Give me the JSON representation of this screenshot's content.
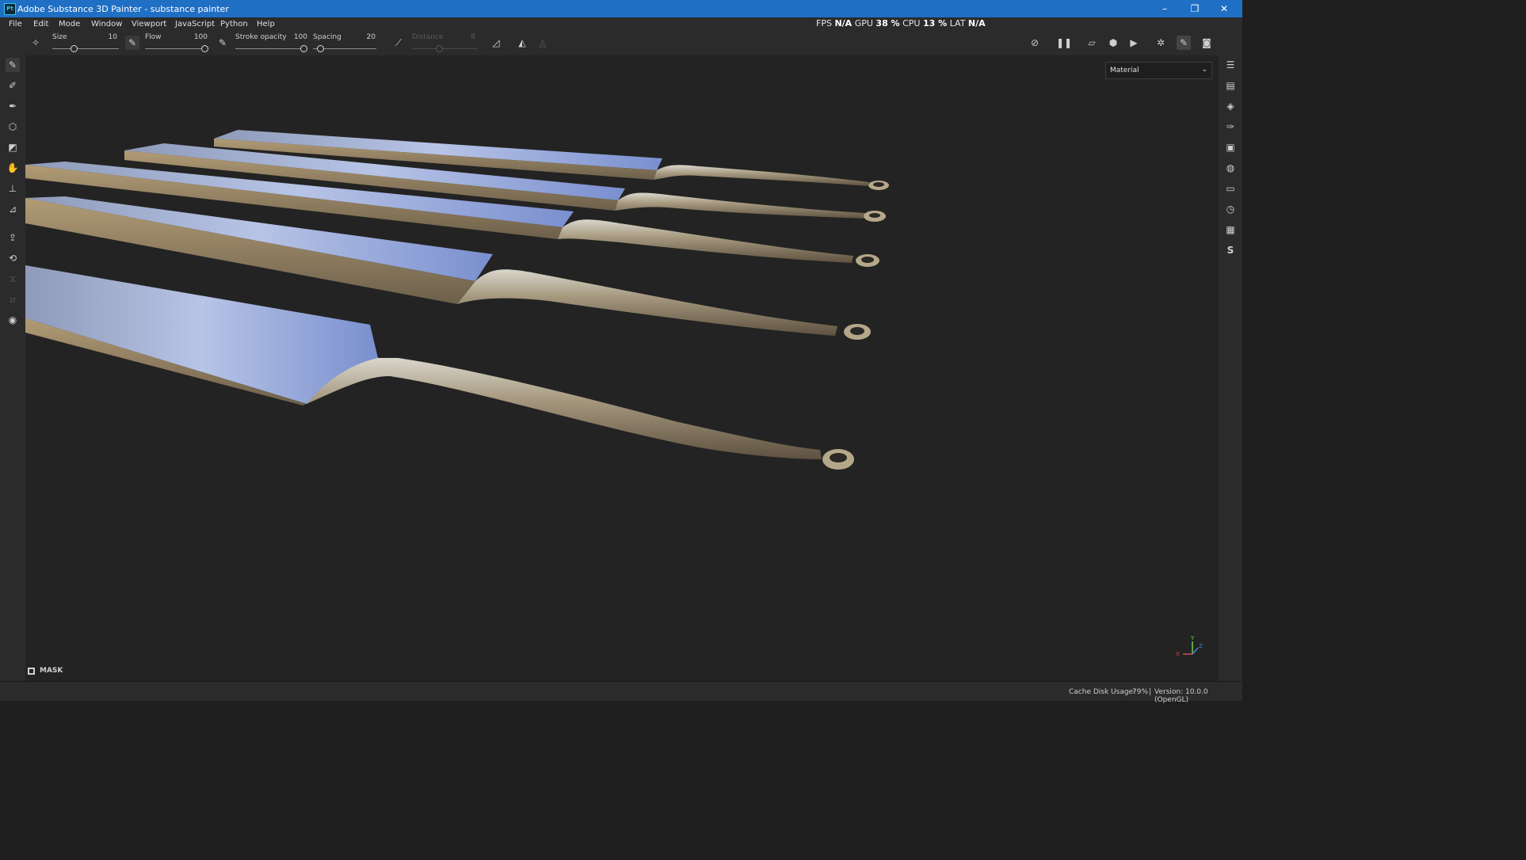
{
  "window": {
    "title": "Adobe Substance 3D Painter - substance painter",
    "logo_text": "Pt",
    "minimize": "–",
    "maximize": "❐",
    "close": "✕"
  },
  "menu": [
    "File",
    "Edit",
    "Mode",
    "Window",
    "Viewport",
    "JavaScript",
    "Python",
    "Help"
  ],
  "performance": {
    "fps_label": "FPS",
    "fps_value": "N/A",
    "gpu_label": "GPU",
    "gpu_value": "38 %",
    "cpu_label": "CPU",
    "cpu_value": "13 %",
    "lat_label": "LAT",
    "lat_value": "N/A"
  },
  "toolbar": {
    "size_label": "Size",
    "size_value": "10",
    "flow_label": "Flow",
    "flow_value": "100",
    "stroke_opacity_label": "Stroke opacity",
    "stroke_opacity_value": "100",
    "spacing_label": "Spacing",
    "spacing_value": "20",
    "distance_label": "Distance",
    "distance_value": "8"
  },
  "viewport": {
    "channel": "Material",
    "mask_label": "MASK",
    "axis_y": "Y",
    "axis_z": "Z",
    "axis_x": "X"
  },
  "status": {
    "cache_label": "Cache Disk Usage:",
    "cache_value": "79%",
    "separator": "|",
    "version": "Version: 10.0.0 (OpenGL)"
  },
  "colors": {
    "titlebar": "#1f6fc5",
    "panel": "#2b2b2b",
    "viewport": "#232323",
    "metal_light": "#9fb4e0",
    "metal_warm": "#c2a978"
  },
  "icons": {
    "left": [
      "paint-brush-icon",
      "eraser-icon",
      "projection-icon",
      "polygon-fill-icon",
      "geometry-mask-icon",
      "smudge-icon",
      "clone-stamp-icon",
      "color-picker-icon",
      "bake-icon",
      "quick-mask-icon",
      "symmetry-icon",
      "measure-icon",
      "screenshot-icon"
    ],
    "right": [
      "layers-icon",
      "texture-set-icon",
      "layer-stack-icon",
      "properties-icon",
      "display-settings-icon",
      "shader-icon",
      "assets-icon",
      "history-icon",
      "log-icon",
      "substance-icon"
    ]
  }
}
